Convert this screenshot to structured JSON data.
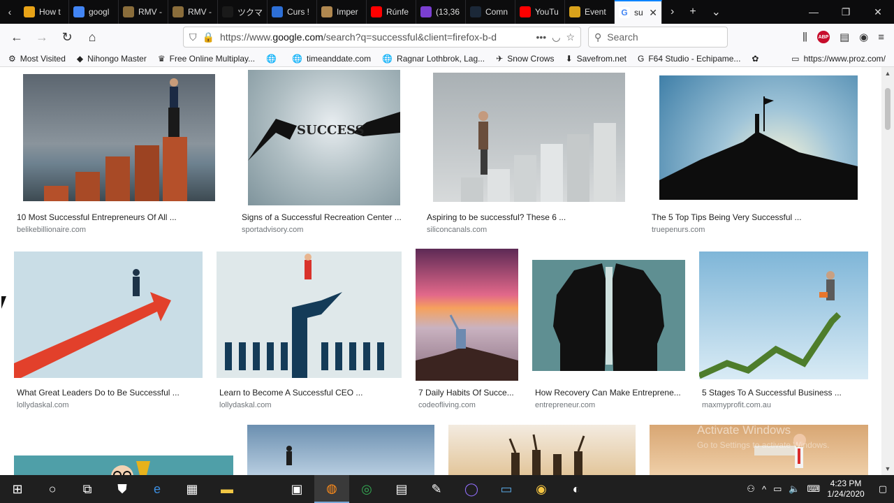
{
  "tabs": [
    {
      "title": "How t",
      "color": "#e8a317"
    },
    {
      "title": "googl",
      "color": "#4285f4"
    },
    {
      "title": "RMV -",
      "color": "#8a6d3b"
    },
    {
      "title": "RMV -",
      "color": "#8a6d3b"
    },
    {
      "title": "ツクマテ",
      "color": "#1a1a1a"
    },
    {
      "title": "Curs !",
      "color": "#2d6fd6"
    },
    {
      "title": "Imper",
      "color": "#b08850"
    },
    {
      "title": "Rúnfe",
      "color": "#ff0000"
    },
    {
      "title": "(13,36",
      "color": "#7b3fd1"
    },
    {
      "title": "Comn",
      "color": "#1b2838"
    },
    {
      "title": "YouTu",
      "color": "#ff0000"
    },
    {
      "title": "Event",
      "color": "#d9a21b"
    }
  ],
  "active_tab": {
    "title": "su",
    "close": "✕"
  },
  "nav": {
    "url_prefix": "https://www.",
    "url_host": "google.com",
    "url_rest": "/search?q=successful&client=firefox-b-d",
    "search_placeholder": "Search"
  },
  "bookmarks": [
    {
      "label": "Most Visited",
      "icon": "⚙"
    },
    {
      "label": "Nihongo Master",
      "icon": "◆"
    },
    {
      "label": "Free Online Multiplay...",
      "icon": "♛"
    },
    {
      "label": "",
      "icon": "🌐"
    },
    {
      "label": "timeanddate.com",
      "icon": "🌐"
    },
    {
      "label": "Ragnar Lothbrok, Lag...",
      "icon": "🌐"
    },
    {
      "label": "Snow Crows",
      "icon": "✈"
    },
    {
      "label": "Savefrom.net",
      "icon": "⬇"
    },
    {
      "label": "F64 Studio - Echipame...",
      "icon": "G"
    },
    {
      "label": "",
      "icon": "✿"
    }
  ],
  "bookmark_right": "https://www.proz.com/",
  "results": [
    {
      "caption": "10 Most Successful Entrepreneurs Of All ...",
      "source": "belikebillionaire.com"
    },
    {
      "caption": "Signs of a Successful Recreation Center ...",
      "source": "sportadvisory.com"
    },
    {
      "caption": "Aspiring to be successful? These 6 ...",
      "source": "siliconcanals.com"
    },
    {
      "caption": "The 5 Top Tips Being Very Successful ...",
      "source": "truepenurs.com"
    },
    {
      "caption": "What Great Leaders Do to Be Successful ...",
      "source": "lollydaskal.com"
    },
    {
      "caption": "Learn to Become A Successful CEO ...",
      "source": "lollydaskal.com"
    },
    {
      "caption": "7 Daily Habits Of Succe...",
      "source": "codeofliving.com"
    },
    {
      "caption": "How Recovery Can Make Entreprene...",
      "source": "entrepreneur.com"
    },
    {
      "caption": "5 Stages To A Successful Business ...",
      "source": "maxmyprofit.com.au"
    }
  ],
  "success_word": "SUCCESS",
  "watermark": {
    "line1": "Activate Windows",
    "line2": "Go to Settings to activate Windows."
  },
  "clock": {
    "time": "4:23 PM",
    "date": "1/24/2020"
  }
}
